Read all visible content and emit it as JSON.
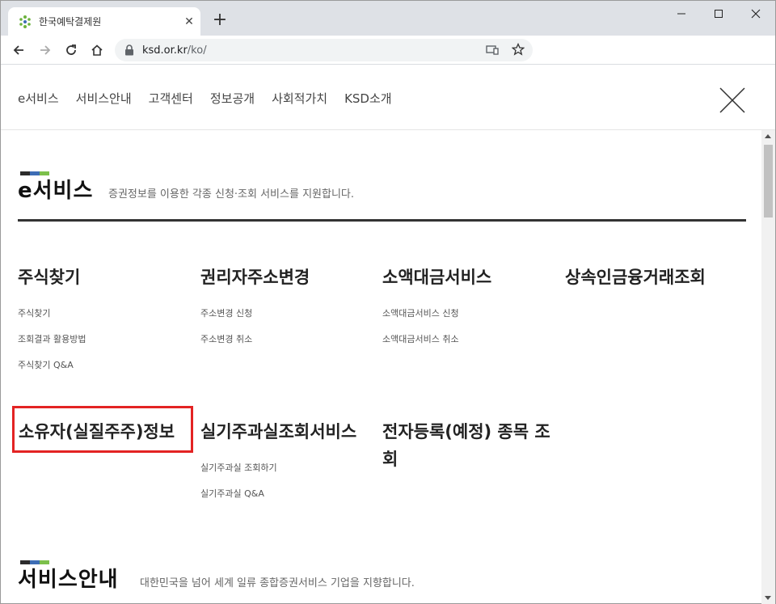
{
  "browser": {
    "tab_title": "한국예탁결제원",
    "tab_close": "✕",
    "new_tab": "+",
    "url_host": "ksd.or.kr",
    "url_path": "/ko/"
  },
  "nav": {
    "items": [
      "e서비스",
      "서비스안내",
      "고객센터",
      "정보공개",
      "사회적가치",
      "KSD소개"
    ]
  },
  "section_eservice": {
    "title": "e서비스",
    "desc": "증권정보를 이용한 각종 신청·조회 서비스를 지원합니다.",
    "mark_colors": [
      "#2c2c2c",
      "#3d6db5",
      "#7cc04b"
    ],
    "columns": [
      {
        "title": "주식찾기",
        "links": [
          "주식찾기",
          "조회결과 활용방법",
          "주식찾기 Q&A"
        ]
      },
      {
        "title": "권리자주소변경",
        "links": [
          "주소변경 신청",
          "주소변경 취소"
        ]
      },
      {
        "title": "소액대금서비스",
        "links": [
          "소액대금서비스 신청",
          "소액대금서비스 취소"
        ]
      },
      {
        "title": "상속인금융거래조회",
        "links": []
      },
      {
        "title": "소유자(실질주주)정보",
        "links": []
      },
      {
        "title": "실기주과실조회서비스",
        "links": [
          "실기주과실 조회하기",
          "실기주과실 Q&A"
        ]
      },
      {
        "title_line1": "전자등록(예정) 종목 조",
        "title_line2": "회",
        "links": []
      }
    ]
  },
  "section_service": {
    "title": "서비스안내",
    "desc": "대한민국을 넘어 세계 일류 종합증권서비스 기업을 지향합니다."
  },
  "colors": {
    "highlight": "#e32323",
    "rule": "#333333"
  }
}
